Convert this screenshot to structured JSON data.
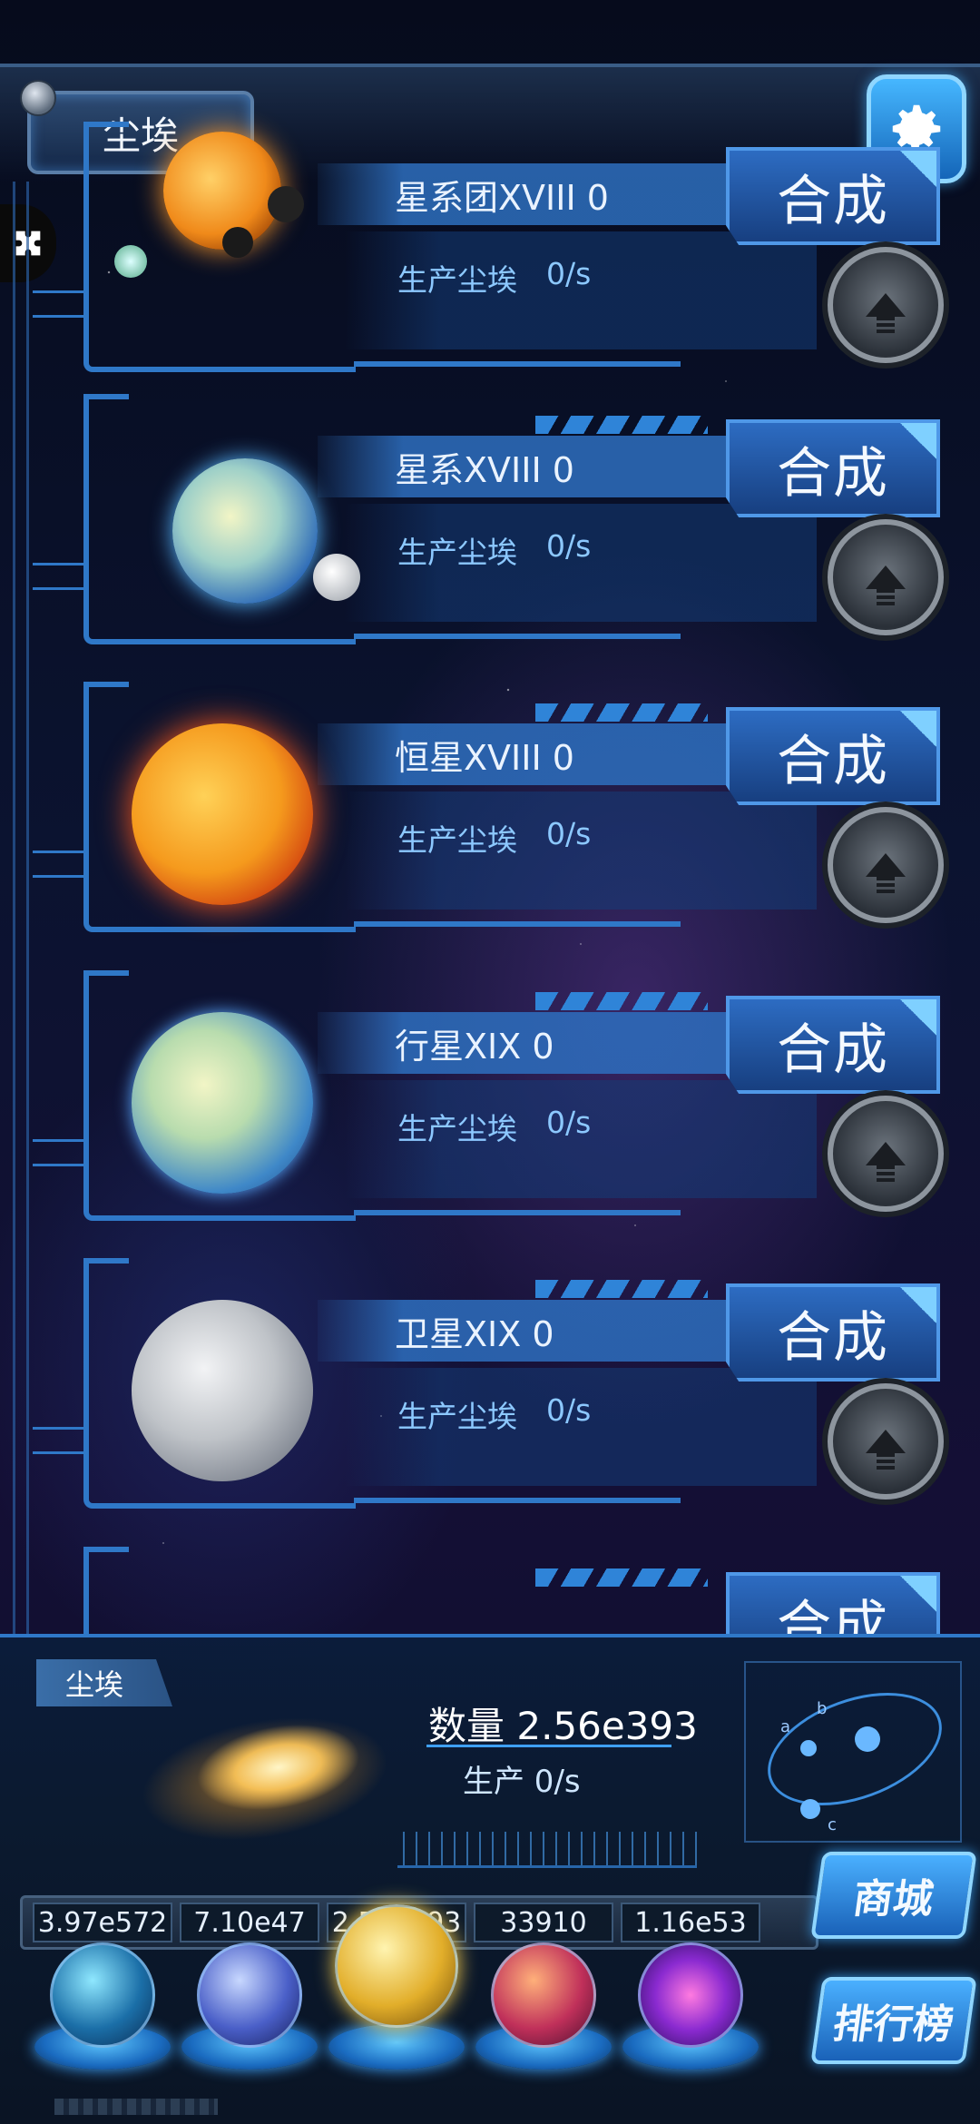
{
  "header": {
    "resource_tab": "尘埃"
  },
  "rows": [
    {
      "name": "星系团XVIII 0",
      "prod_label": "生产尘埃",
      "prod_value": "0/s",
      "merge_label": "合成",
      "icon": "galaxy-cluster"
    },
    {
      "name": "星系XVIII 0",
      "prod_label": "生产尘埃",
      "prod_value": "0/s",
      "merge_label": "合成",
      "icon": "galaxy"
    },
    {
      "name": "恒星XVIII 0",
      "prod_label": "生产尘埃",
      "prod_value": "0/s",
      "merge_label": "合成",
      "icon": "star"
    },
    {
      "name": "行星XIX 0",
      "prod_label": "生产尘埃",
      "prod_value": "0/s",
      "merge_label": "合成",
      "icon": "planet"
    },
    {
      "name": "卫星XIX 0",
      "prod_label": "生产尘埃",
      "prod_value": "0/s",
      "merge_label": "合成",
      "icon": "moon"
    },
    {
      "merge_label": "合成"
    }
  ],
  "bottom": {
    "title": "尘埃",
    "quantity_label": "数量 2.56e393",
    "production_label": "生产 0/s",
    "orbit_labels": [
      "a",
      "b",
      "c"
    ]
  },
  "stats": [
    "3.97e572",
    "7.10e47",
    "2.56e393",
    "33910",
    "1.16e53"
  ],
  "side_buttons": {
    "shop": "商城",
    "leaderboard": "排行榜"
  },
  "colors": {
    "accent": "#2f78c8",
    "button": "#2d6cc2",
    "text": "#cfe6ff"
  }
}
